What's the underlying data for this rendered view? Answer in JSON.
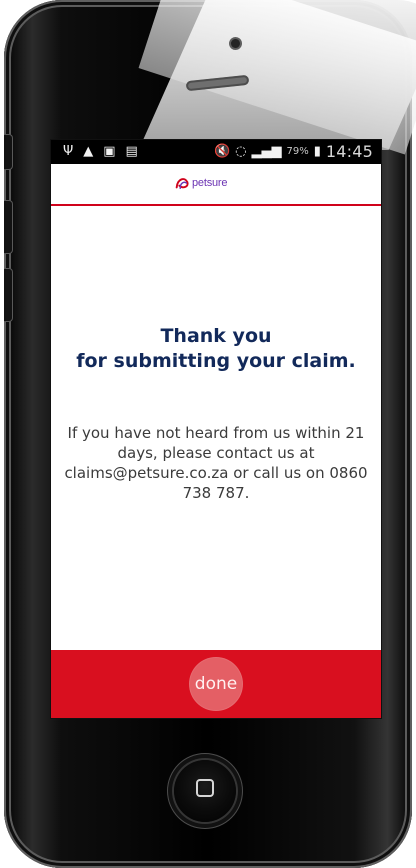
{
  "status_bar": {
    "left_icons": [
      "usb-icon",
      "warning-icon",
      "image-icon",
      "document-icon"
    ],
    "right_icons": [
      "mute-icon",
      "wifi-icon",
      "signal-icon",
      "battery-icon"
    ],
    "battery_percent": "79%",
    "time": "14:45"
  },
  "header": {
    "logo_text": "petsure"
  },
  "message": {
    "title_line_1": "Thank you",
    "title_line_2": "for submitting your claim.",
    "body": "If you have not heard from us within 21 days, please contact us at claims@petsure.co.za or call us on 0860 738 787."
  },
  "footer": {
    "button_label": "done"
  },
  "colors": {
    "brand_red": "#d90f1f",
    "title_navy": "#12295a",
    "logo_purple": "#6b33b3"
  }
}
